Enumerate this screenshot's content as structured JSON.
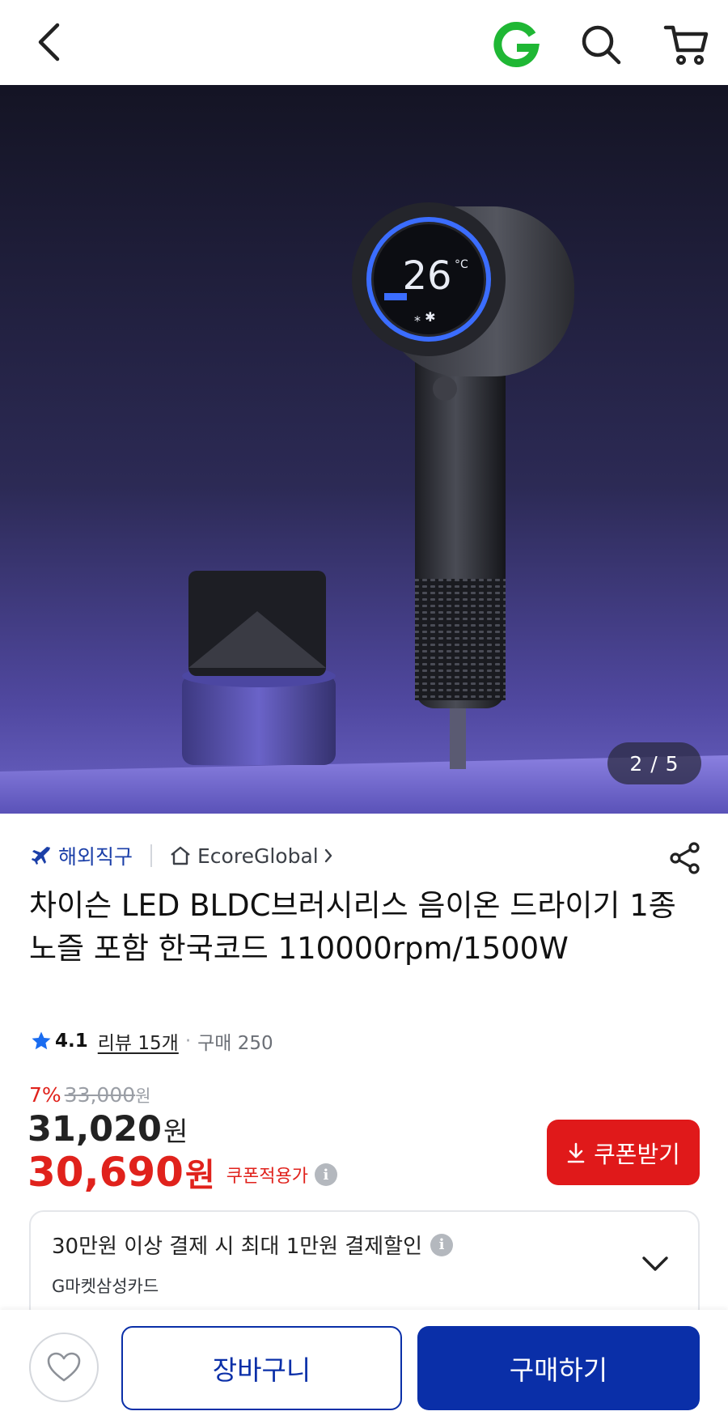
{
  "header": {
    "icons": [
      "chevron-left-icon",
      "gmarket-g-icon",
      "search-icon",
      "cart-icon"
    ],
    "brand_color": "#1fb734"
  },
  "gallery": {
    "current": "2",
    "total": "5",
    "counter_text": "2 / 5",
    "display_temp": "26",
    "display_unit": "°C"
  },
  "seller": {
    "overseas_label": "해외직구",
    "shop_name": "EcoreGlobal",
    "share_icon": "share-icon"
  },
  "product": {
    "title": "차이슨 LED BLDC브러시리스 음이온 드라이기 1종노즐 포함 한국코드 110000rpm/1500W"
  },
  "rating": {
    "score": "4.1",
    "reviews": "리뷰 15개",
    "separator": "·",
    "purchases": "구매 250"
  },
  "price": {
    "discount_rate": "7%",
    "original": "33,000",
    "original_unit": "원",
    "sale": "31,020",
    "sale_unit": "원",
    "coupon_price": "30,690",
    "coupon_unit": "원",
    "coupon_label": "쿠폰적용가",
    "info": "i",
    "coupon_button": "쿠폰받기",
    "accent_color": "#e0221c"
  },
  "promo": {
    "headline": "30만원 이상 결제 시 최대 1만원 결제할인",
    "info": "i",
    "card": "G마켓삼성카드"
  },
  "bottom": {
    "cart_label": "장바구니",
    "buy_label": "구매하기",
    "primary_color": "#0a2fa8"
  }
}
